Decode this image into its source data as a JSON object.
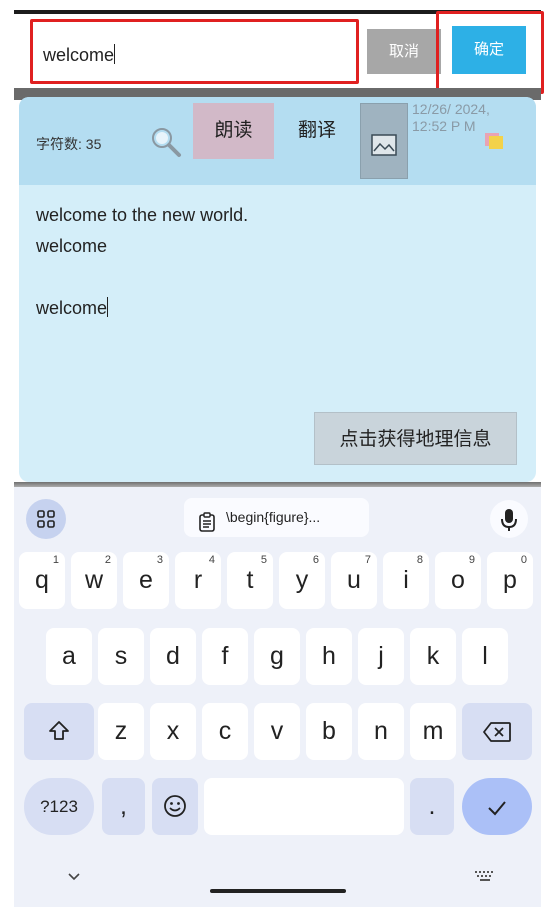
{
  "search": {
    "value": "welcome"
  },
  "top_actions": {
    "cancel_label": "取消",
    "confirm_label": "确定"
  },
  "note": {
    "char_count_label": "字符数: 35",
    "read_label": "朗读",
    "translate_label": "翻译",
    "date_text": "12/26/ 2024, 12:52 P M",
    "lines": [
      "welcome to the new world.",
      "welcome",
      "",
      "welcome"
    ],
    "geo_button_label": "点击获得地理信息"
  },
  "keyboard": {
    "clipboard_label": "\\begin{figure}...",
    "row1": [
      {
        "key": "q",
        "hint": "1"
      },
      {
        "key": "w",
        "hint": "2"
      },
      {
        "key": "e",
        "hint": "3"
      },
      {
        "key": "r",
        "hint": "4"
      },
      {
        "key": "t",
        "hint": "5"
      },
      {
        "key": "y",
        "hint": "6"
      },
      {
        "key": "u",
        "hint": "7"
      },
      {
        "key": "i",
        "hint": "8"
      },
      {
        "key": "o",
        "hint": "9"
      },
      {
        "key": "p",
        "hint": "0"
      }
    ],
    "row2": [
      "a",
      "s",
      "d",
      "f",
      "g",
      "h",
      "j",
      "k",
      "l"
    ],
    "row3": [
      "z",
      "x",
      "c",
      "v",
      "b",
      "n",
      "m"
    ],
    "numbers_label": "?123",
    "comma_label": ",",
    "period_label": "."
  },
  "colors": {
    "highlight_border": "#e02020",
    "confirm": "#2db0e6",
    "cancel": "#a7a7a7",
    "panel": "#d4eef9",
    "panel_header": "#b4ddf1",
    "read_button": "#d2b9c8",
    "enter_key": "#abc0f7"
  }
}
